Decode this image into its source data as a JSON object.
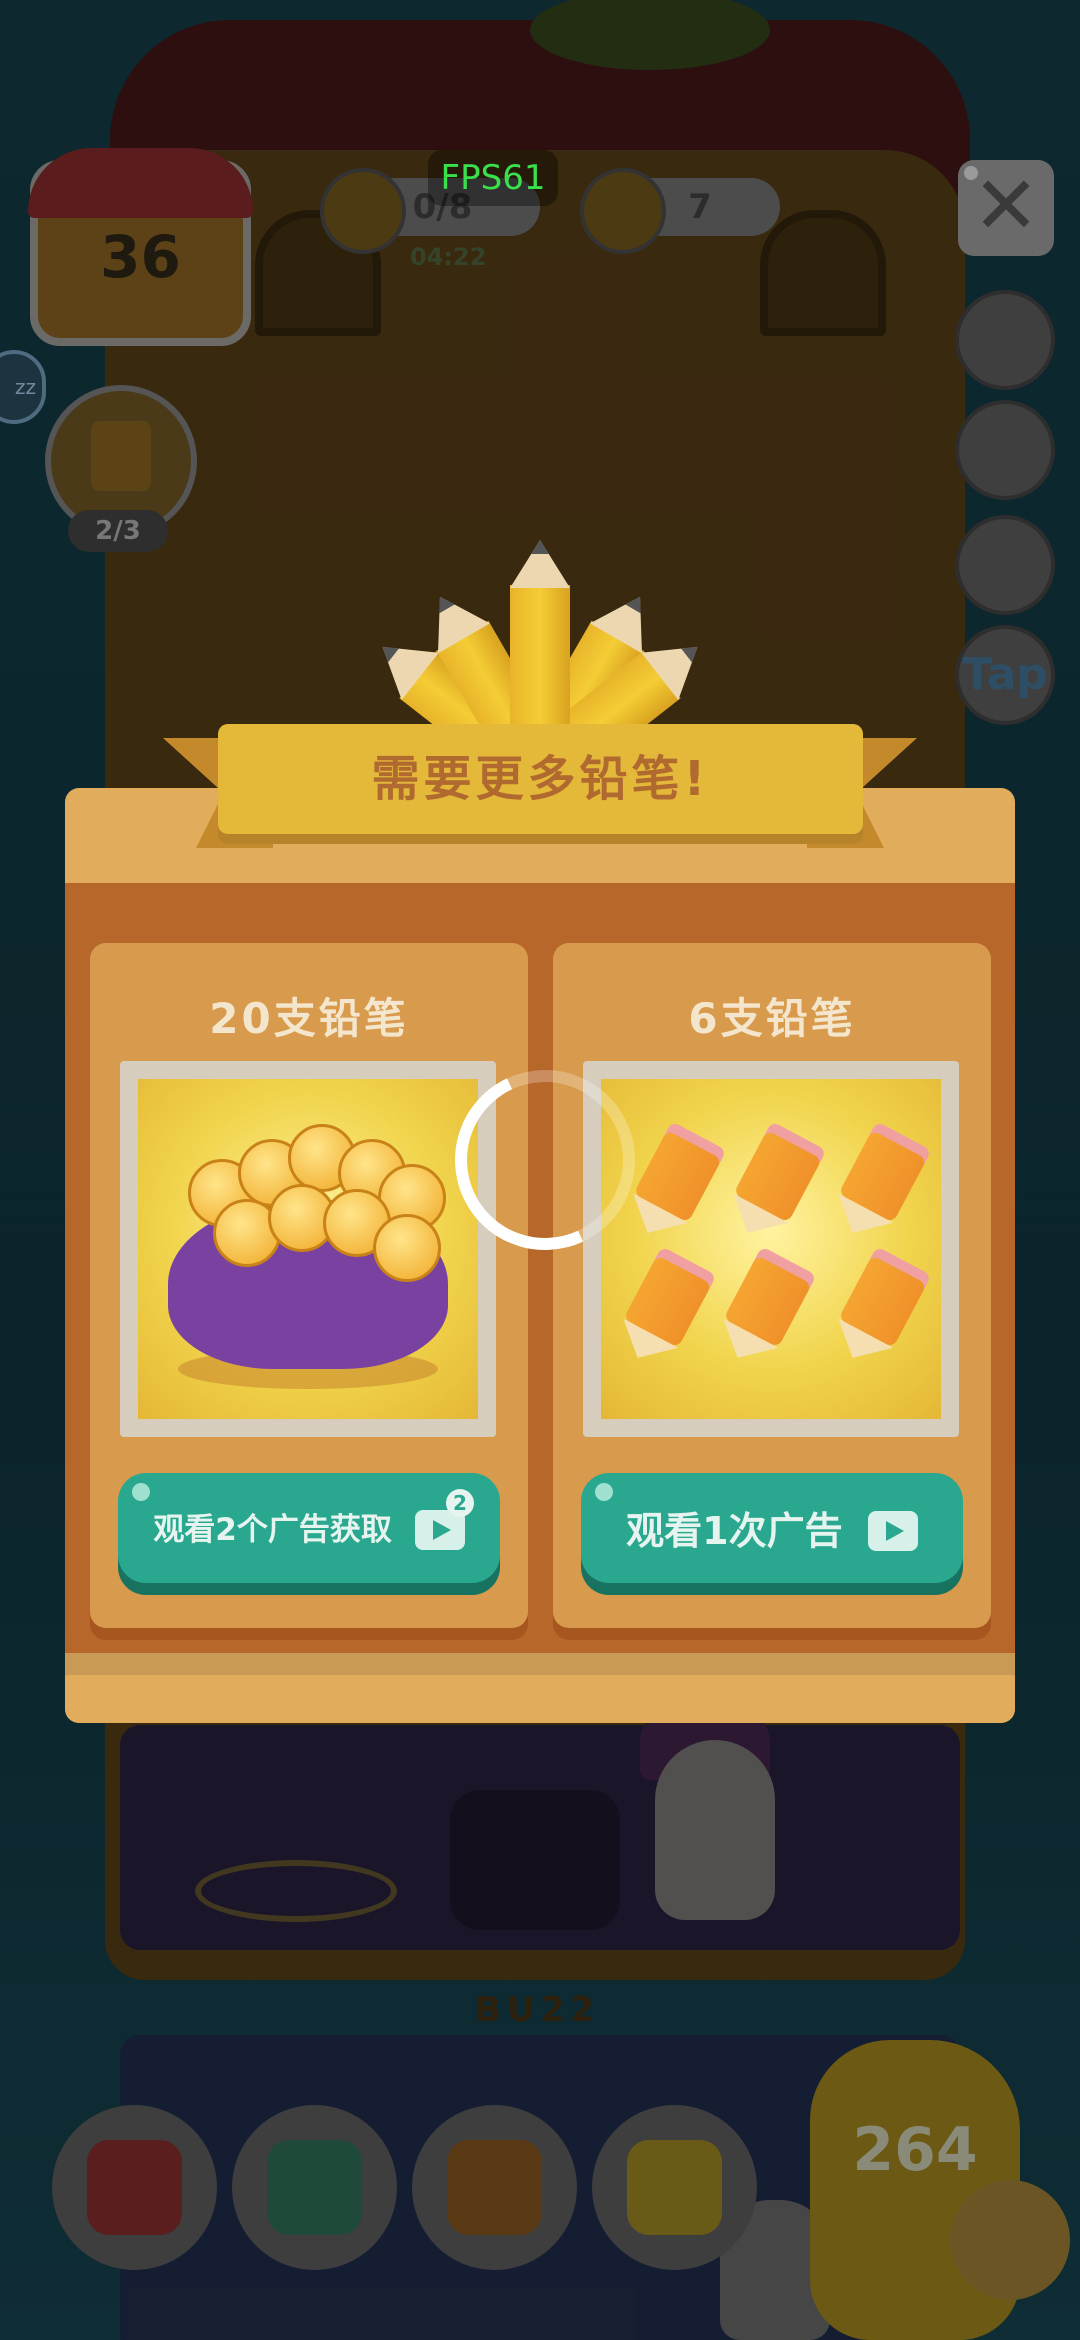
{
  "hud": {
    "level": "36",
    "pencil_progress": "0/8",
    "paint_count": "7",
    "timer": "04:22",
    "fps": "FPS61",
    "close_symbol": "✕",
    "tap_label": "Tap",
    "task_progress": "2/3",
    "edge_chip": "zz"
  },
  "dialog": {
    "title": "需要更多铅笔!",
    "options": [
      {
        "title": "20支铅笔",
        "button": "观看2个广告获取",
        "badge": "2",
        "image": "pencil-bag-icon"
      },
      {
        "title": "6支铅笔",
        "button": "观看1次广告",
        "badge": "",
        "image": "six-pencils-icon"
      }
    ]
  },
  "bottom": {
    "currency": "264",
    "floor_sign": "BU22"
  },
  "colors": {
    "dialog_bg": "#e1ac5b",
    "dialog_inner": "#b8672a",
    "ribbon": "#e4b93a",
    "button_green": "#2aa88f",
    "fps_green": "#38e04a"
  }
}
